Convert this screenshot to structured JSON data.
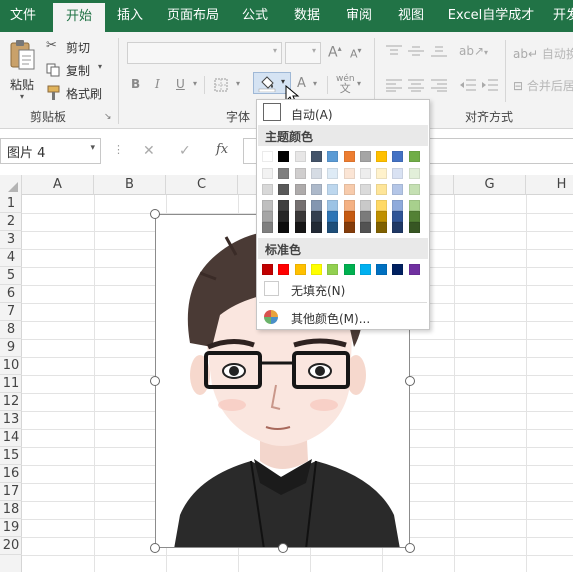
{
  "tabs": [
    {
      "label": "文件",
      "active": false
    },
    {
      "label": "开始",
      "active": true
    },
    {
      "label": "插入",
      "active": false
    },
    {
      "label": "页面布局",
      "active": false
    },
    {
      "label": "公式",
      "active": false
    },
    {
      "label": "数据",
      "active": false
    },
    {
      "label": "审阅",
      "active": false
    },
    {
      "label": "视图",
      "active": false
    },
    {
      "label": "Excel自学成才",
      "active": false
    },
    {
      "label": "开发",
      "active": false
    }
  ],
  "clipboard": {
    "paste": "粘贴",
    "cut": "剪切",
    "copy": "复制",
    "format_painter": "格式刷",
    "group": "剪贴板"
  },
  "font": {
    "group": "字体",
    "bold": "B",
    "italic": "I",
    "underline": "U",
    "grow": "A",
    "shrink": "A",
    "font_color": "A",
    "phonetic": "wén"
  },
  "alignment": {
    "group": "对齐方式",
    "wrap": "自动换行",
    "merge": "合并后居中"
  },
  "namebox": {
    "value": "图片 4"
  },
  "formula_bar": {
    "cancel": "✕",
    "enter": "✓",
    "fx": "fx"
  },
  "columns": [
    "A",
    "B",
    "C",
    "D",
    "E",
    "F",
    "G",
    "H"
  ],
  "rows": [
    "1",
    "2",
    "3",
    "4",
    "5",
    "6",
    "7",
    "8",
    "9",
    "10",
    "11",
    "12",
    "13",
    "14",
    "15",
    "16",
    "17",
    "18",
    "19",
    "20"
  ],
  "fill_menu": {
    "automatic": "自动(A)",
    "theme_title": "主题颜色",
    "standard_title": "标准色",
    "no_fill": "无填充(N)",
    "more_colors": "其他颜色(M)..."
  },
  "theme_colors": [
    [
      "#FFFFFF",
      "#000000",
      "#E7E6E6",
      "#44546A",
      "#5B9BD5",
      "#ED7D31",
      "#A5A5A5",
      "#FFC000",
      "#4472C4",
      "#70AD47"
    ],
    [
      "#F2F2F2",
      "#7F7F7F",
      "#D0CECE",
      "#D6DCE4",
      "#DEEBF6",
      "#FBE5D5",
      "#EDEDED",
      "#FFF2CC",
      "#D9E2F3",
      "#E2EFD9"
    ],
    [
      "#D8D8D8",
      "#595959",
      "#AEABAB",
      "#ADB9CA",
      "#BDD7EE",
      "#F7CBAC",
      "#DBDBDB",
      "#FEE599",
      "#B4C6E7",
      "#C5E0B3"
    ],
    [
      "#BFBFBF",
      "#3F3F3F",
      "#757070",
      "#8496B0",
      "#9CC3E5",
      "#F4B183",
      "#C9C9C9",
      "#FFD965",
      "#8EAADB",
      "#A8D08D"
    ],
    [
      "#A5A5A5",
      "#262626",
      "#3A3838",
      "#333F4F",
      "#2E75B5",
      "#C55A11",
      "#7B7B7B",
      "#BF9000",
      "#2F5496",
      "#538135"
    ],
    [
      "#7F7F7F",
      "#0C0C0C",
      "#171616",
      "#222A35",
      "#1E4E79",
      "#833C0B",
      "#525252",
      "#7F6000",
      "#1F3864",
      "#375623"
    ]
  ],
  "standard_colors": [
    "#C00000",
    "#FF0000",
    "#FFC000",
    "#FFFF00",
    "#92D050",
    "#00B050",
    "#00B0F0",
    "#0070C0",
    "#002060",
    "#7030A0"
  ],
  "colors": {
    "ribbon_green": "#217346",
    "ribbon_bg": "#f3f3f3"
  }
}
